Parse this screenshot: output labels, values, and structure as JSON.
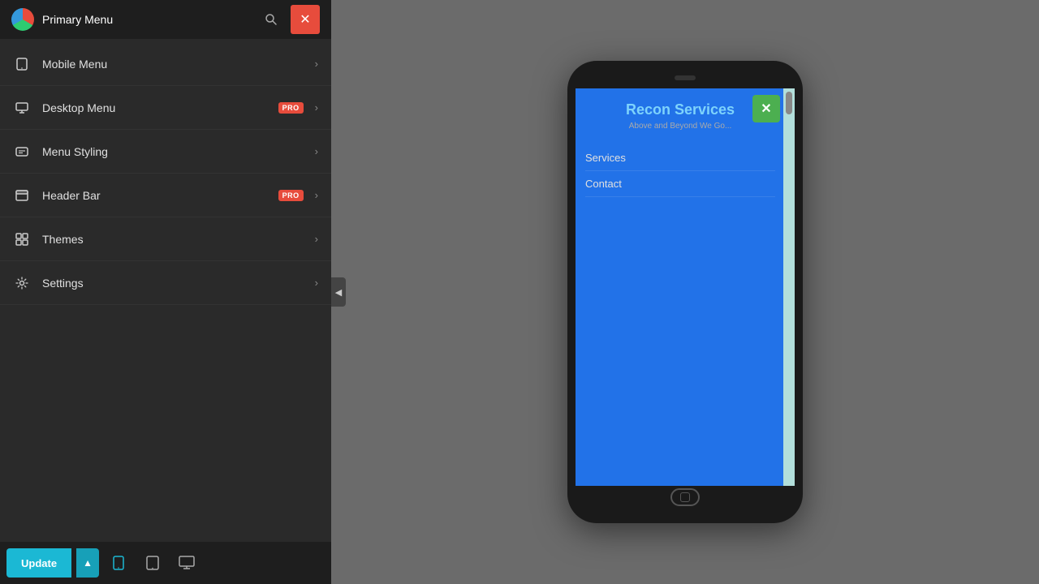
{
  "sidebar": {
    "header": {
      "title": "Primary Menu",
      "close_label": "×",
      "search_label": "🔍"
    },
    "nav_items": [
      {
        "id": "mobile-menu",
        "label": "Mobile Menu",
        "icon": "mobile",
        "has_pro": false,
        "has_arrow": true
      },
      {
        "id": "desktop-menu",
        "label": "Desktop Menu",
        "icon": "desktop",
        "has_pro": true,
        "has_arrow": true
      },
      {
        "id": "menu-styling",
        "label": "Menu Styling",
        "icon": "styling",
        "has_pro": false,
        "has_arrow": true
      },
      {
        "id": "header-bar",
        "label": "Header Bar",
        "icon": "header",
        "has_pro": true,
        "has_arrow": true
      },
      {
        "id": "themes",
        "label": "Themes",
        "icon": "themes",
        "has_pro": false,
        "has_arrow": true
      },
      {
        "id": "settings",
        "label": "Settings",
        "icon": "settings",
        "has_pro": false,
        "has_arrow": true
      }
    ],
    "pro_badge": "PRO",
    "footer": {
      "update_label": "Update",
      "arrow_label": "▲",
      "devices": [
        "mobile",
        "tablet",
        "desktop"
      ]
    }
  },
  "preview": {
    "site_title": "Recon Services",
    "site_subtitle": "Above and Beyond We Go...",
    "close_label": "✕",
    "nav_links": [
      "Services",
      "Contact"
    ]
  }
}
